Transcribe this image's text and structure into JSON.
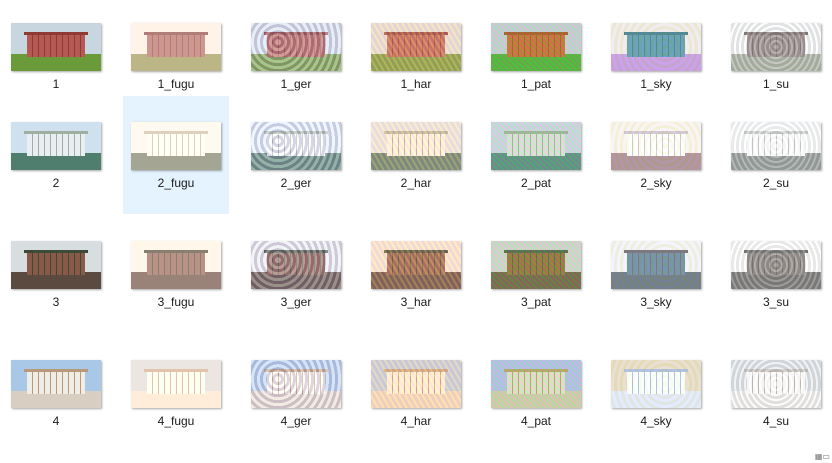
{
  "explorer": {
    "items": [
      {
        "label": "1",
        "image": "1",
        "style": "orig"
      },
      {
        "label": "1_fugu",
        "image": "1",
        "style": "fugu"
      },
      {
        "label": "1_ger",
        "image": "1",
        "style": "ger"
      },
      {
        "label": "1_har",
        "image": "1",
        "style": "har"
      },
      {
        "label": "1_pat",
        "image": "1",
        "style": "pat"
      },
      {
        "label": "1_sky",
        "image": "1",
        "style": "sky"
      },
      {
        "label": "1_su",
        "image": "1",
        "style": "su"
      },
      {
        "label": "2",
        "image": "2",
        "style": "orig"
      },
      {
        "label": "2_fugu",
        "image": "2",
        "style": "fugu",
        "selected": true
      },
      {
        "label": "2_ger",
        "image": "2",
        "style": "ger"
      },
      {
        "label": "2_har",
        "image": "2",
        "style": "har"
      },
      {
        "label": "2_pat",
        "image": "2",
        "style": "pat"
      },
      {
        "label": "2_sky",
        "image": "2",
        "style": "sky"
      },
      {
        "label": "2_su",
        "image": "2",
        "style": "su"
      },
      {
        "label": "3",
        "image": "3",
        "style": "orig"
      },
      {
        "label": "3_fugu",
        "image": "3",
        "style": "fugu"
      },
      {
        "label": "3_ger",
        "image": "3",
        "style": "ger"
      },
      {
        "label": "3_har",
        "image": "3",
        "style": "har"
      },
      {
        "label": "3_pat",
        "image": "3",
        "style": "pat"
      },
      {
        "label": "3_sky",
        "image": "3",
        "style": "sky"
      },
      {
        "label": "3_su",
        "image": "3",
        "style": "su"
      },
      {
        "label": "4",
        "image": "4",
        "style": "orig"
      },
      {
        "label": "4_fugu",
        "image": "4",
        "style": "fugu"
      },
      {
        "label": "4_ger",
        "image": "4",
        "style": "ger"
      },
      {
        "label": "4_har",
        "image": "4",
        "style": "har"
      },
      {
        "label": "4_pat",
        "image": "4",
        "style": "pat"
      },
      {
        "label": "4_sky",
        "image": "4",
        "style": "sky"
      },
      {
        "label": "4_su",
        "image": "4",
        "style": "su"
      }
    ]
  },
  "colors": {
    "selection": "#e5f3ff",
    "label_text": "#1a1a1a"
  },
  "icons": {
    "view_toggle": "grid-view-icon"
  }
}
